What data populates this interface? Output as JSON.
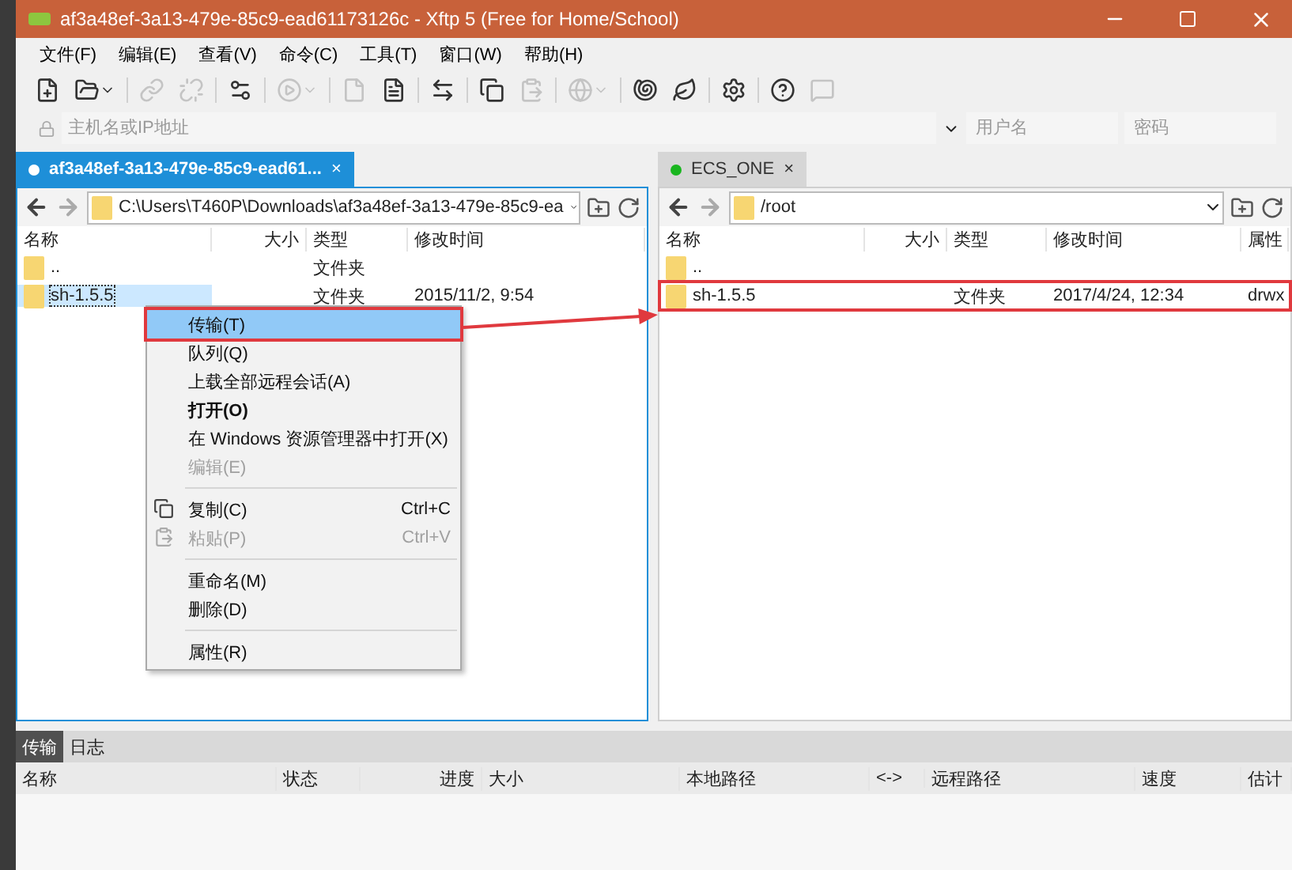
{
  "window": {
    "title": "af3a48ef-3a13-479e-85c9-ead61173126c - Xftp 5 (Free for Home/School)"
  },
  "menu": [
    "文件(F)",
    "编辑(E)",
    "查看(V)",
    "命令(C)",
    "工具(T)",
    "窗口(W)",
    "帮助(H)"
  ],
  "toolbar": [
    {
      "kind": "new",
      "disabled": false
    },
    {
      "kind": "open",
      "disabled": false,
      "dropdown": true
    },
    {
      "kind": "sep"
    },
    {
      "kind": "link",
      "disabled": true
    },
    {
      "kind": "unlink",
      "disabled": true
    },
    {
      "kind": "sep"
    },
    {
      "kind": "props",
      "disabled": false
    },
    {
      "kind": "sep"
    },
    {
      "kind": "play",
      "disabled": true,
      "dropdown": true
    },
    {
      "kind": "sep"
    },
    {
      "kind": "file",
      "disabled": true
    },
    {
      "kind": "doc",
      "disabled": false
    },
    {
      "kind": "sep"
    },
    {
      "kind": "swap",
      "disabled": false
    },
    {
      "kind": "sep"
    },
    {
      "kind": "copy",
      "disabled": false
    },
    {
      "kind": "paste",
      "disabled": true
    },
    {
      "kind": "sep"
    },
    {
      "kind": "globe",
      "disabled": true,
      "dropdown": true
    },
    {
      "kind": "sep"
    },
    {
      "kind": "shell",
      "disabled": false
    },
    {
      "kind": "leaf",
      "disabled": false
    },
    {
      "kind": "sep"
    },
    {
      "kind": "gear",
      "disabled": false
    },
    {
      "kind": "sep"
    },
    {
      "kind": "help",
      "disabled": false
    },
    {
      "kind": "chat",
      "disabled": true
    }
  ],
  "address": {
    "host_placeholder": "主机名或IP地址",
    "user_placeholder": "用户名",
    "password_placeholder": "密码"
  },
  "left_pane": {
    "tab": {
      "label": "af3a48ef-3a13-479e-85c9-ead61...",
      "close": "×",
      "connected": false,
      "selected": true
    },
    "path": "C:\\Users\\T460P\\Downloads\\af3a48ef-3a13-479e-85c9-ea",
    "columns": [
      "名称",
      "大小",
      "类型",
      "修改时间"
    ],
    "rows": [
      {
        "name": "..",
        "type": "文件夹",
        "selected": false,
        "annotated": false
      },
      {
        "name": "sh-1.5.5",
        "type": "文件夹",
        "modified": "2015/11/2, 9:54",
        "selected": true,
        "annotated": false
      }
    ]
  },
  "right_pane": {
    "tab": {
      "label": "ECS_ONE",
      "close": "×",
      "connected": true,
      "selected": false
    },
    "path": "/root",
    "columns": [
      "名称",
      "大小",
      "类型",
      "修改时间",
      "属性"
    ],
    "rows": [
      {
        "name": "..",
        "selected": false,
        "annotated": false
      },
      {
        "name": "sh-1.5.5",
        "type": "文件夹",
        "modified": "2017/4/24, 12:34",
        "attributes": "drwx",
        "selected": false,
        "annotated": true
      }
    ]
  },
  "context_menu": [
    {
      "kind": "item",
      "label": "传输(T)",
      "highlighted": true,
      "annotated": true,
      "disabled": false,
      "bold": false
    },
    {
      "kind": "item",
      "label": "队列(Q)",
      "highlighted": false,
      "annotated": false,
      "disabled": false,
      "bold": false
    },
    {
      "kind": "item",
      "label": "上载全部远程会话(A)",
      "highlighted": false,
      "annotated": false,
      "disabled": false,
      "bold": false
    },
    {
      "kind": "item",
      "label": "打开(O)",
      "highlighted": false,
      "annotated": false,
      "disabled": false,
      "bold": true
    },
    {
      "kind": "item",
      "label": "在 Windows 资源管理器中打开(X)",
      "highlighted": false,
      "annotated": false,
      "disabled": false,
      "bold": false
    },
    {
      "kind": "item",
      "label": "编辑(E)",
      "highlighted": false,
      "annotated": false,
      "disabled": true,
      "bold": false
    },
    {
      "kind": "separator"
    },
    {
      "kind": "copy",
      "label": "复制(C)",
      "shortcut": "Ctrl+C",
      "highlighted": false,
      "annotated": false,
      "disabled": false,
      "bold": false
    },
    {
      "kind": "paste",
      "label": "粘贴(P)",
      "shortcut": "Ctrl+V",
      "highlighted": false,
      "annotated": false,
      "disabled": true,
      "bold": false
    },
    {
      "kind": "separator"
    },
    {
      "kind": "item",
      "label": "重命名(M)",
      "highlighted": false,
      "annotated": false,
      "disabled": false,
      "bold": false
    },
    {
      "kind": "item",
      "label": "删除(D)",
      "highlighted": false,
      "annotated": false,
      "disabled": false,
      "bold": false
    },
    {
      "kind": "separator"
    },
    {
      "kind": "item",
      "label": "属性(R)",
      "highlighted": false,
      "annotated": false,
      "disabled": false,
      "bold": false
    }
  ],
  "transfer": {
    "tabs": [
      {
        "label": "传输",
        "selected": true
      },
      {
        "label": "日志",
        "selected": false
      }
    ],
    "columns": [
      "名称",
      "状态",
      "进度",
      "大小",
      "本地路径",
      "<->",
      "远程路径",
      "速度",
      "估计"
    ]
  }
}
